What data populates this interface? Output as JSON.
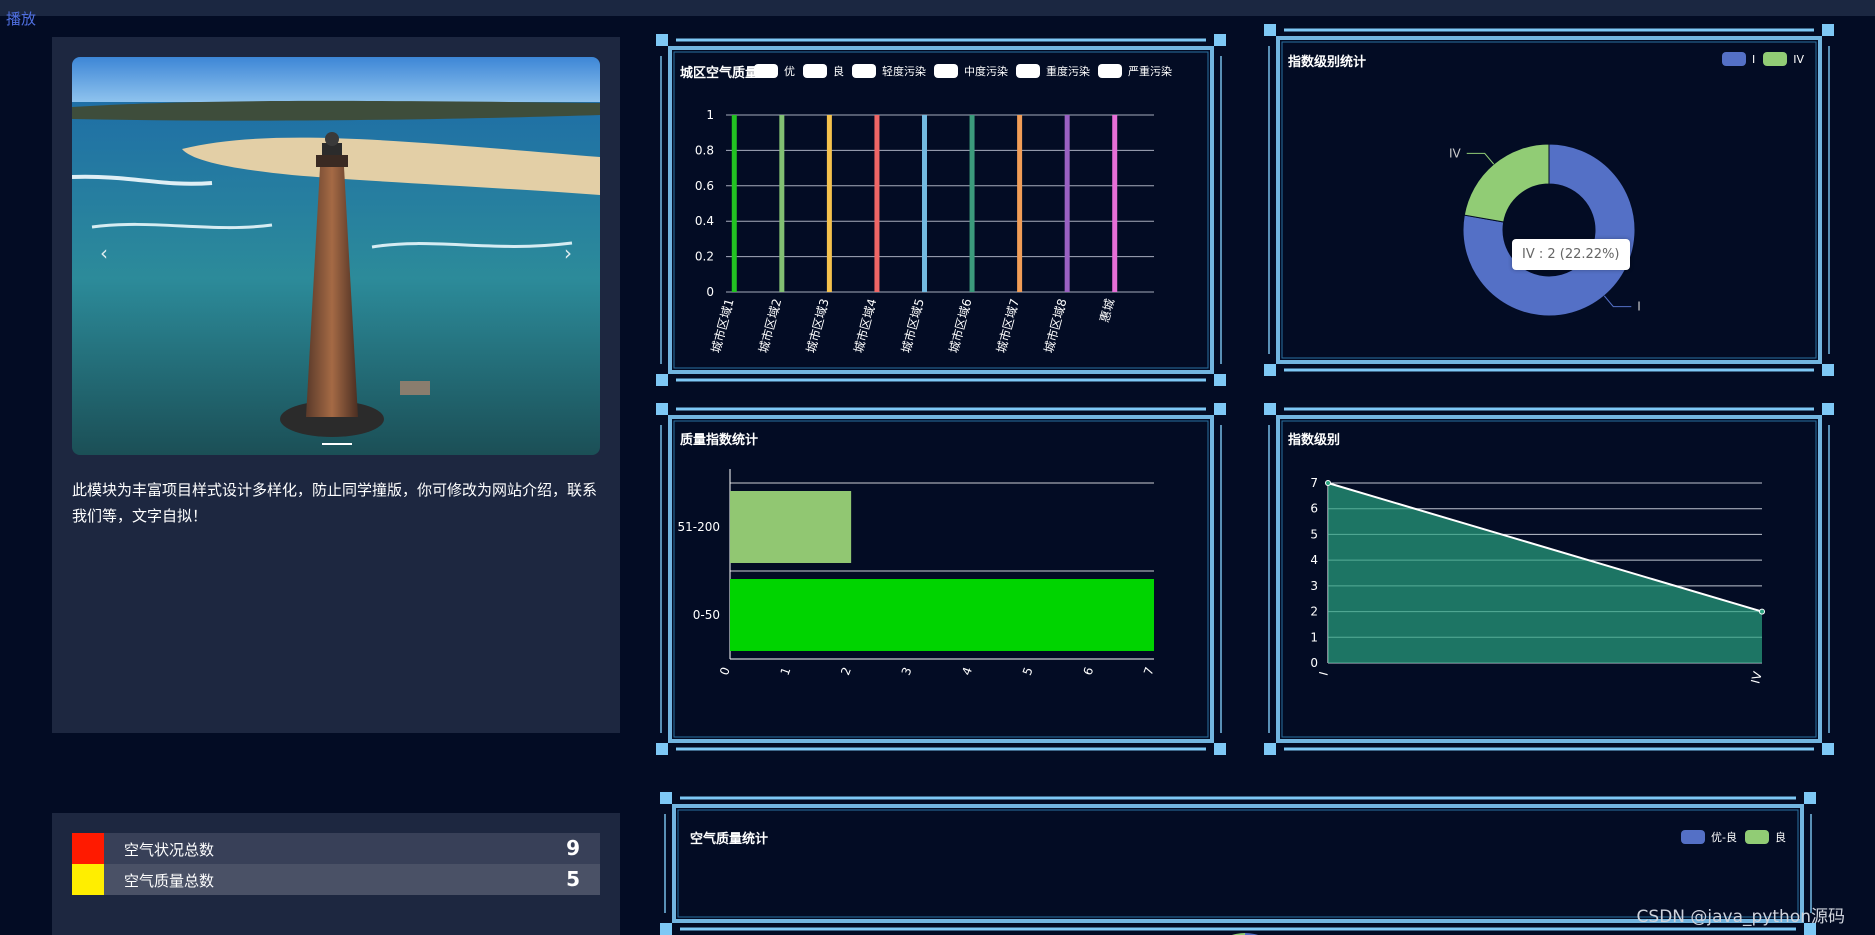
{
  "header": {
    "play_label": "播放"
  },
  "left_panel": {
    "intro_text": "此模块为丰富项目样式设计多样化，防止同学撞版，你可修改为网站介绍，联系我们等，文字自拟！",
    "carousel": {
      "prev_icon": "‹",
      "next_icon": "›"
    }
  },
  "stats": [
    {
      "label": "空气状况总数",
      "value": "9",
      "color": "#ff1a00"
    },
    {
      "label": "空气质量总数",
      "value": "5",
      "color": "#ffee00"
    }
  ],
  "panels": {
    "city_air": {
      "title": "城区空气质量",
      "legend": [
        "优",
        "良",
        "轻度污染",
        "中度污染",
        "重度污染",
        "严重污染"
      ]
    },
    "index_level_stats": {
      "title": "指数级别统计",
      "legend": [
        "I",
        "IV"
      ],
      "tooltip": "IV : 2 (22.22%)"
    },
    "quality_index": {
      "title": "质量指数统计"
    },
    "index_level": {
      "title": "指数级别"
    },
    "air_quality": {
      "title": "空气质量统计",
      "legend": [
        "优-良",
        "良"
      ]
    }
  },
  "watermark": "CSDN @java_python源码",
  "chart_data": [
    {
      "type": "bar",
      "title": "城区空气质量",
      "categories": [
        "城市区域1",
        "城市区域2",
        "城市区域3",
        "城市区域4",
        "城市区域5",
        "城市区域6",
        "城市区域7",
        "城市区域8",
        "惠城"
      ],
      "values": [
        1,
        1,
        1,
        1,
        1,
        1,
        1,
        1,
        1
      ],
      "colors": [
        "#22c322",
        "#82c073",
        "#f5c24d",
        "#ee6666",
        "#73b9e0",
        "#3c9b7c",
        "#f19d57",
        "#9a61c2",
        "#e76fd7"
      ],
      "yticks": [
        "0",
        "0.2",
        "0.4",
        "0.6",
        "0.8",
        "1"
      ],
      "ylim": [
        0,
        1
      ]
    },
    {
      "type": "pie",
      "title": "指数级别统计",
      "slices": [
        {
          "name": "I",
          "value": 7,
          "color": "#5470c6"
        },
        {
          "name": "IV",
          "value": 2,
          "color": "#91cc75"
        }
      ]
    },
    {
      "type": "bar",
      "orientation": "horizontal",
      "title": "质量指数统计",
      "categories": [
        "0-50",
        "51-200"
      ],
      "values": [
        7,
        2
      ],
      "colors": [
        "#00d400",
        "#91c772"
      ],
      "xticks": [
        "0",
        "1",
        "2",
        "3",
        "4",
        "5",
        "6",
        "7"
      ],
      "xlim": [
        0,
        7
      ]
    },
    {
      "type": "area",
      "title": "指数级别",
      "categories": [
        "I",
        "IV"
      ],
      "values": [
        7,
        2
      ],
      "yticks": [
        "0",
        "1",
        "2",
        "3",
        "4",
        "5",
        "6",
        "7"
      ],
      "ylim": [
        0,
        7
      ]
    },
    {
      "type": "pie",
      "title": "空气质量统计",
      "slices": [
        {
          "name": "优-良",
          "color": "#5470c6"
        },
        {
          "name": "良",
          "color": "#91cc75"
        }
      ]
    }
  ]
}
